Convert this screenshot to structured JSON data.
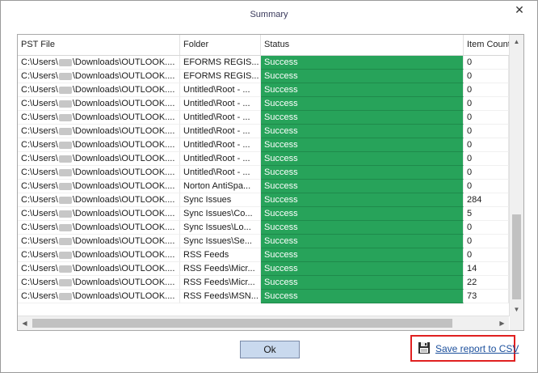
{
  "dialog": {
    "title": "Summary",
    "close_glyph": "✕"
  },
  "table": {
    "columns": [
      "PST File",
      "Folder",
      "Status",
      "Item Count"
    ],
    "rows": [
      {
        "file_prefix": "C:\\Users\\",
        "file_suffix": "\\Downloads\\OUTLOOK....",
        "folder": "EFORMS REGIS...",
        "status": "Success",
        "count": "0"
      },
      {
        "file_prefix": "C:\\Users\\",
        "file_suffix": "\\Downloads\\OUTLOOK....",
        "folder": "EFORMS REGIS...",
        "status": "Success",
        "count": "0"
      },
      {
        "file_prefix": "C:\\Users\\",
        "file_suffix": "\\Downloads\\OUTLOOK....",
        "folder": "Untitled\\Root - ...",
        "status": "Success",
        "count": "0"
      },
      {
        "file_prefix": "C:\\Users\\",
        "file_suffix": "\\Downloads\\OUTLOOK....",
        "folder": "Untitled\\Root - ...",
        "status": "Success",
        "count": "0"
      },
      {
        "file_prefix": "C:\\Users\\",
        "file_suffix": "\\Downloads\\OUTLOOK....",
        "folder": "Untitled\\Root - ...",
        "status": "Success",
        "count": "0"
      },
      {
        "file_prefix": "C:\\Users\\",
        "file_suffix": "\\Downloads\\OUTLOOK....",
        "folder": "Untitled\\Root - ...",
        "status": "Success",
        "count": "0"
      },
      {
        "file_prefix": "C:\\Users\\",
        "file_suffix": "\\Downloads\\OUTLOOK....",
        "folder": "Untitled\\Root - ...",
        "status": "Success",
        "count": "0"
      },
      {
        "file_prefix": "C:\\Users\\",
        "file_suffix": "\\Downloads\\OUTLOOK....",
        "folder": "Untitled\\Root - ...",
        "status": "Success",
        "count": "0"
      },
      {
        "file_prefix": "C:\\Users\\",
        "file_suffix": "\\Downloads\\OUTLOOK....",
        "folder": "Untitled\\Root - ...",
        "status": "Success",
        "count": "0"
      },
      {
        "file_prefix": "C:\\Users\\",
        "file_suffix": "\\Downloads\\OUTLOOK....",
        "folder": "Norton AntiSpa...",
        "status": "Success",
        "count": "0"
      },
      {
        "file_prefix": "C:\\Users\\",
        "file_suffix": "\\Downloads\\OUTLOOK....",
        "folder": "Sync Issues",
        "status": "Success",
        "count": "284"
      },
      {
        "file_prefix": "C:\\Users\\",
        "file_suffix": "\\Downloads\\OUTLOOK....",
        "folder": "Sync Issues\\Co...",
        "status": "Success",
        "count": "5"
      },
      {
        "file_prefix": "C:\\Users\\",
        "file_suffix": "\\Downloads\\OUTLOOK....",
        "folder": "Sync Issues\\Lo...",
        "status": "Success",
        "count": "0"
      },
      {
        "file_prefix": "C:\\Users\\",
        "file_suffix": "\\Downloads\\OUTLOOK....",
        "folder": "Sync Issues\\Se...",
        "status": "Success",
        "count": "0"
      },
      {
        "file_prefix": "C:\\Users\\",
        "file_suffix": "\\Downloads\\OUTLOOK....",
        "folder": "RSS Feeds",
        "status": "Success",
        "count": "0"
      },
      {
        "file_prefix": "C:\\Users\\",
        "file_suffix": "\\Downloads\\OUTLOOK....",
        "folder": "RSS Feeds\\Micr...",
        "status": "Success",
        "count": "14"
      },
      {
        "file_prefix": "C:\\Users\\",
        "file_suffix": "\\Downloads\\OUTLOOK....",
        "folder": "RSS Feeds\\Micr...",
        "status": "Success",
        "count": "22"
      },
      {
        "file_prefix": "C:\\Users\\",
        "file_suffix": "\\Downloads\\OUTLOOK....",
        "folder": "RSS Feeds\\MSN...",
        "status": "Success",
        "count": "73"
      }
    ]
  },
  "footer": {
    "ok_label": "Ok",
    "save_report_label": "Save report to CSV"
  },
  "colors": {
    "status_success": "#27a35a",
    "highlight_box": "#e02020",
    "link": "#1b4f9c",
    "ok_button": "#c9d9ee"
  },
  "icons": {
    "close": "close-icon",
    "save": "floppy-disk-icon",
    "scroll_up": "chevron-up-icon",
    "scroll_down": "chevron-down-icon",
    "scroll_left": "chevron-left-icon",
    "scroll_right": "chevron-right-icon"
  }
}
